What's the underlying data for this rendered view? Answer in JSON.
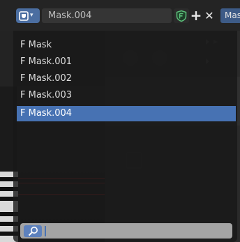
{
  "header": {
    "datablock_name": "Mask.004",
    "mode_label": "Mask"
  },
  "dropdown": {
    "items": [
      "F Mask",
      "F Mask.001",
      "F Mask.002",
      "F Mask.003",
      "F Mask.004"
    ],
    "selected": "F Mask.004",
    "search_value": ""
  },
  "colors": {
    "accent": "#4772b3",
    "fake_user": "#5cbf7a"
  }
}
